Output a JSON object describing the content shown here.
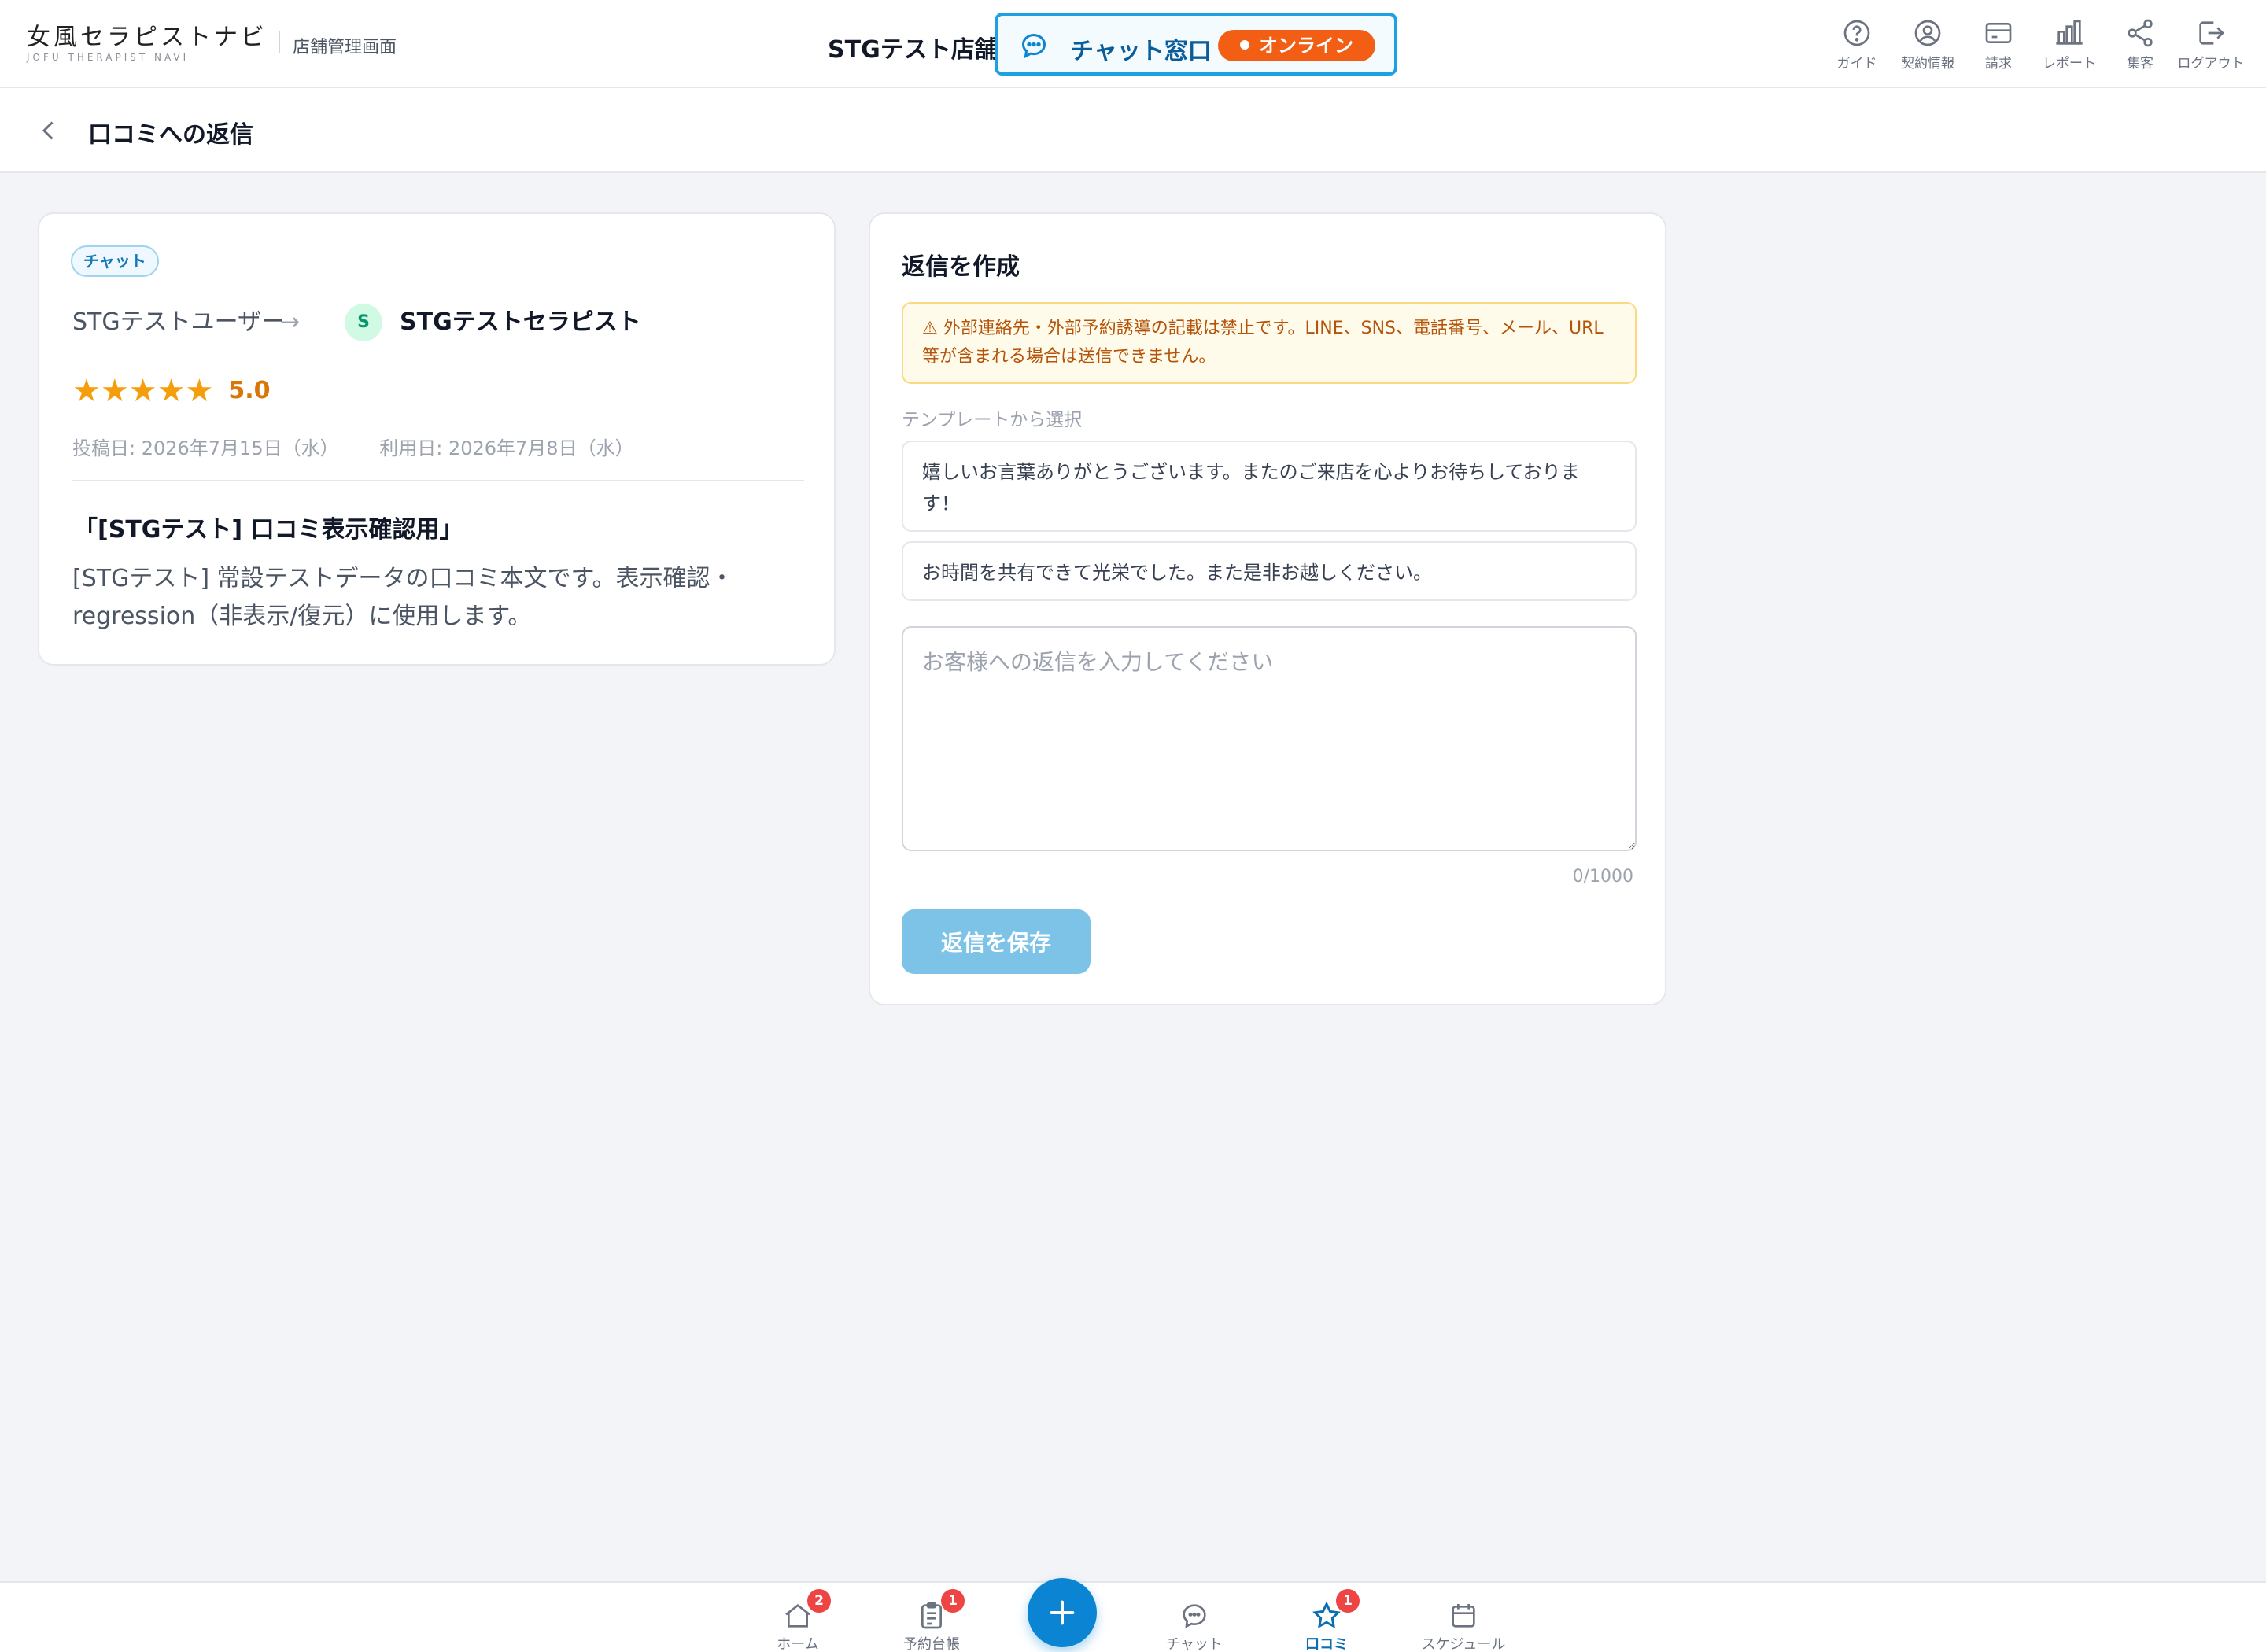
{
  "brand": {
    "logo_text": "女風セラピストナビ",
    "logo_sub": "JOFU THERAPIST NAVI",
    "admin_label": "店舗管理画面"
  },
  "header": {
    "store_name": "STGテスト店舗",
    "chat_label": "チャット窓口",
    "online_label": "オンライン",
    "icons": [
      {
        "icon": "help-circle-icon",
        "label": "ガイド"
      },
      {
        "icon": "user-circle-icon",
        "label": "契約情報"
      },
      {
        "icon": "credit-card-icon",
        "label": "請求"
      },
      {
        "icon": "bar-chart-icon",
        "label": "レポート"
      },
      {
        "icon": "share-icon",
        "label": "集客"
      },
      {
        "icon": "logout-icon",
        "label": "ログアウト"
      }
    ]
  },
  "page": {
    "title": "口コミへの返信"
  },
  "review": {
    "channel_chip": "チャット",
    "from_user": "STGテストユーザー",
    "arrow": "→",
    "therapist_initial": "S",
    "therapist_name": "STGテストセラピスト",
    "rating_stars": "★★★★★",
    "rating_value": "5.0",
    "posted_date": "投稿日: 2026年7月15日（水）",
    "used_date": "利用日: 2026年7月8日（水）",
    "title": "「[STGテスト] 口コミ表示確認用」",
    "body": "[STGテスト] 常設テストデータの口コミ本文です。表示確認・regression（非表示/復元）に使用します。"
  },
  "compose": {
    "title": "返信を作成",
    "warning": "⚠ 外部連絡先・外部予約誘導の記載は禁止です。LINE、SNS、電話番号、メール、URL等が含まれる場合は送信できません。",
    "template_label": "テンプレートから選択",
    "templates": [
      "嬉しいお言葉ありがとうございます。またのご来店を心よりお待ちしております！",
      "お時間を共有できて光栄でした。また是非お越しください。"
    ],
    "reply_value": "",
    "reply_placeholder": "お客様への返信を入力してください",
    "counter": "0/1000",
    "save_label": "返信を保存"
  },
  "bottom_nav": {
    "items": [
      {
        "icon": "home-icon",
        "label": "ホーム",
        "badge": "2"
      },
      {
        "icon": "clipboard-icon",
        "label": "予約台帳",
        "badge": "1"
      },
      {
        "icon": "chat-icon",
        "label": "チャット",
        "badge": ""
      },
      {
        "icon": "star-icon",
        "label": "口コミ",
        "badge": "1"
      },
      {
        "icon": "calendar-icon",
        "label": "スケジュール",
        "badge": ""
      }
    ],
    "fab_icon": "plus-icon",
    "active": "口コミ"
  },
  "colors": {
    "accent": "#0b84d4",
    "online": "#f25f14",
    "star": "#f59e0b",
    "badge": "#ef4444",
    "warning_bg": "#fffbea"
  }
}
